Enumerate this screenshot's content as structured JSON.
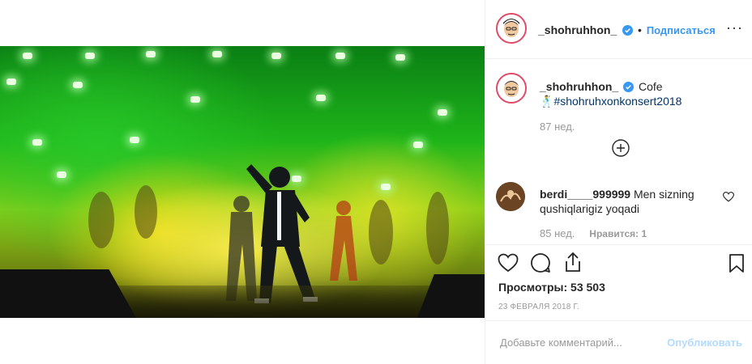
{
  "header": {
    "username": "_shohruhhon_",
    "follow_label": "Подписаться",
    "more_label": "···"
  },
  "caption": {
    "username": "_shohruhhon_",
    "text": "Cofe",
    "hashtag_prefix": "🕺",
    "hashtag": "#shohruhxonkonsert2018",
    "time": "87 нед."
  },
  "comments": [
    {
      "username": "berdi____999999",
      "text_line1": "Men sizning",
      "text_line2": "qushiqlarigiz yoqadi",
      "time": "85 нед.",
      "likes": "Нравится: 1"
    }
  ],
  "actions": {
    "views": "Просмотры: 53 503",
    "date": "23 ФЕВРАЛЯ 2018 Г."
  },
  "composer": {
    "placeholder": "Добавьте комментарий...",
    "publish_label": "Опубликовать"
  },
  "colors": {
    "accent": "#3897f0",
    "verified": "#3897f0",
    "hashtag": "#003569",
    "muted": "#999999",
    "ring": "#e04a66"
  }
}
